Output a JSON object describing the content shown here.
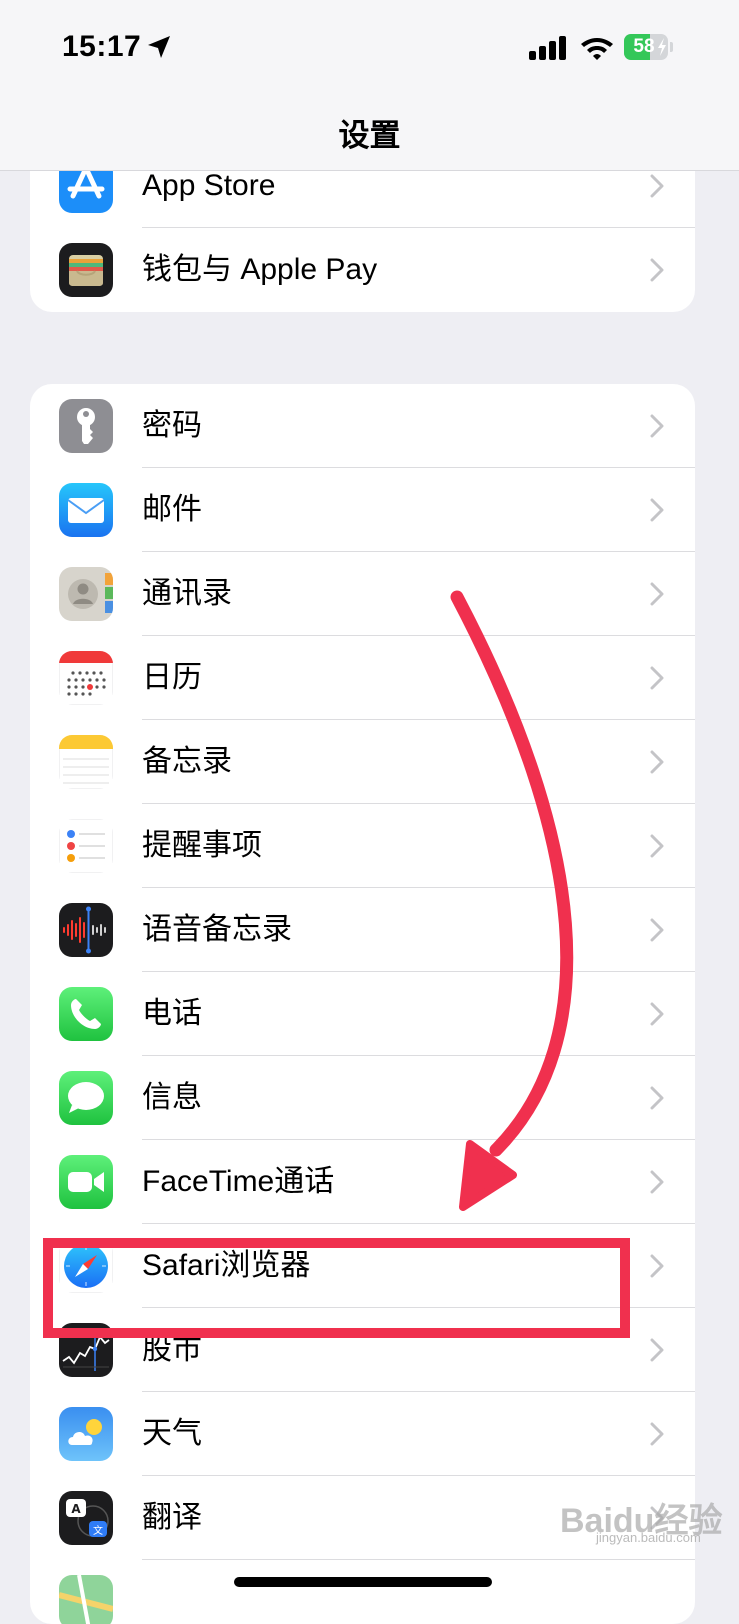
{
  "status_bar": {
    "time": "15:17",
    "battery_level": "58"
  },
  "nav": {
    "title": "设置"
  },
  "group1": {
    "items": [
      {
        "label": "App Store",
        "icon": "app-store-icon"
      },
      {
        "label": "钱包与 Apple Pay",
        "icon": "wallet-icon"
      }
    ]
  },
  "group2": {
    "items": [
      {
        "label": "密码",
        "icon": "key-icon"
      },
      {
        "label": "邮件",
        "icon": "mail-icon"
      },
      {
        "label": "通讯录",
        "icon": "contacts-icon"
      },
      {
        "label": "日历",
        "icon": "calendar-icon"
      },
      {
        "label": "备忘录",
        "icon": "notes-icon"
      },
      {
        "label": "提醒事项",
        "icon": "reminders-icon"
      },
      {
        "label": "语音备忘录",
        "icon": "voice-memos-icon"
      },
      {
        "label": "电话",
        "icon": "phone-icon"
      },
      {
        "label": "信息",
        "icon": "messages-icon"
      },
      {
        "label": "FaceTime通话",
        "icon": "facetime-icon"
      },
      {
        "label": "Safari浏览器",
        "icon": "safari-icon"
      },
      {
        "label": "股市",
        "icon": "stocks-icon"
      },
      {
        "label": "天气",
        "icon": "weather-icon"
      },
      {
        "label": "翻译",
        "icon": "translate-icon"
      }
    ]
  },
  "annotation": {
    "highlighted_item": "Safari浏览器",
    "color": "#f0304e"
  },
  "watermark": {
    "text": "Baidu经验",
    "sub": "jingyan.baidu.com"
  }
}
